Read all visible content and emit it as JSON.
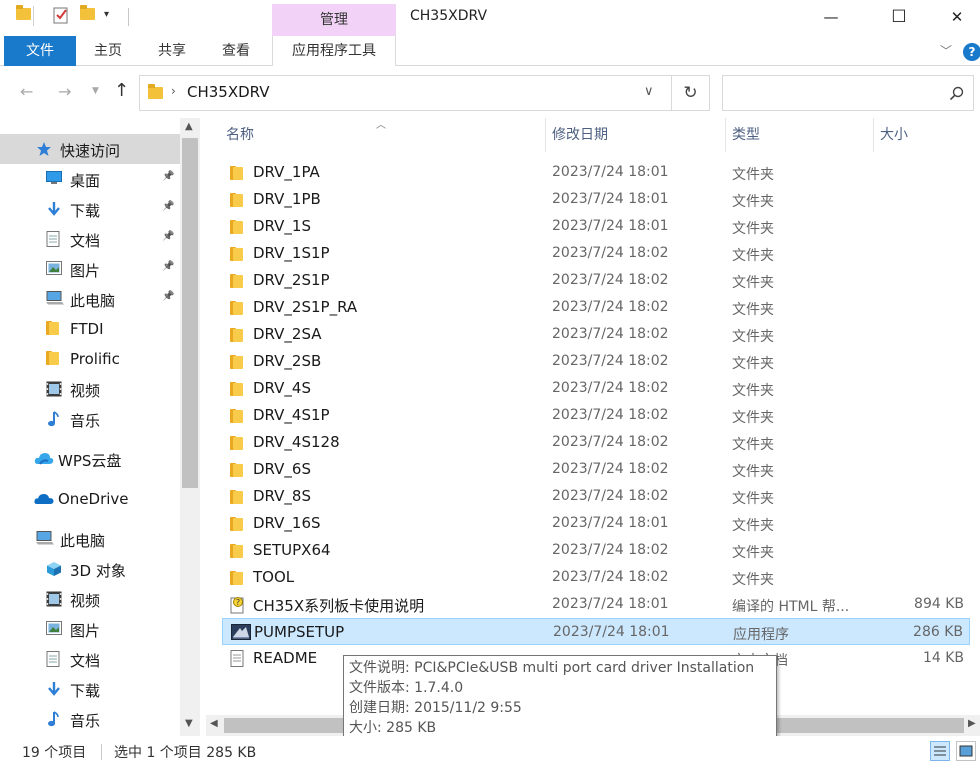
{
  "window": {
    "title": "CH35XDRV",
    "context_group_label": "管理",
    "minimize": "—",
    "maximize": "☐",
    "close": "✕"
  },
  "ribbon": {
    "tabs": [
      "文件",
      "主页",
      "共享",
      "查看",
      "应用程序工具"
    ],
    "help": "?"
  },
  "address": {
    "path": "CH35XDRV",
    "search_placeholder": ""
  },
  "nav": {
    "items": [
      {
        "label": "快速访问",
        "icon": "star-icon",
        "pinned": false
      },
      {
        "label": "桌面",
        "icon": "desktop-icon",
        "pinned": true
      },
      {
        "label": "下载",
        "icon": "download-icon",
        "pinned": true
      },
      {
        "label": "文档",
        "icon": "document-icon",
        "pinned": true
      },
      {
        "label": "图片",
        "icon": "picture-icon",
        "pinned": true
      },
      {
        "label": "此电脑",
        "icon": "computer-icon",
        "pinned": true
      },
      {
        "label": "FTDI",
        "icon": "folder-icon",
        "pinned": false
      },
      {
        "label": "Prolific",
        "icon": "folder-icon",
        "pinned": false
      },
      {
        "label": "视频",
        "icon": "video-icon",
        "pinned": false
      },
      {
        "label": "音乐",
        "icon": "music-icon",
        "pinned": false
      },
      {
        "label": "WPS云盘",
        "icon": "cloud-icon",
        "pinned": false
      },
      {
        "label": "OneDrive",
        "icon": "onedrive-icon",
        "pinned": false
      },
      {
        "label": "此电脑",
        "icon": "computer-icon",
        "pinned": false
      },
      {
        "label": "3D 对象",
        "icon": "cube-icon",
        "pinned": false
      },
      {
        "label": "视频",
        "icon": "video-icon",
        "pinned": false
      },
      {
        "label": "图片",
        "icon": "picture-icon",
        "pinned": false
      },
      {
        "label": "文档",
        "icon": "document-icon",
        "pinned": false
      },
      {
        "label": "下载",
        "icon": "download-icon",
        "pinned": false
      },
      {
        "label": "音乐",
        "icon": "music-icon",
        "pinned": false
      }
    ]
  },
  "columns": {
    "name": "名称",
    "date": "修改日期",
    "type": "类型",
    "size": "大小"
  },
  "files": [
    {
      "name": "DRV_1PA",
      "date": "2023/7/24 18:01",
      "type": "文件夹",
      "size": "",
      "icon": "folder-icon"
    },
    {
      "name": "DRV_1PB",
      "date": "2023/7/24 18:01",
      "type": "文件夹",
      "size": "",
      "icon": "folder-icon"
    },
    {
      "name": "DRV_1S",
      "date": "2023/7/24 18:01",
      "type": "文件夹",
      "size": "",
      "icon": "folder-icon"
    },
    {
      "name": "DRV_1S1P",
      "date": "2023/7/24 18:02",
      "type": "文件夹",
      "size": "",
      "icon": "folder-icon"
    },
    {
      "name": "DRV_2S1P",
      "date": "2023/7/24 18:02",
      "type": "文件夹",
      "size": "",
      "icon": "folder-icon"
    },
    {
      "name": "DRV_2S1P_RA",
      "date": "2023/7/24 18:02",
      "type": "文件夹",
      "size": "",
      "icon": "folder-icon"
    },
    {
      "name": "DRV_2SA",
      "date": "2023/7/24 18:02",
      "type": "文件夹",
      "size": "",
      "icon": "folder-icon"
    },
    {
      "name": "DRV_2SB",
      "date": "2023/7/24 18:02",
      "type": "文件夹",
      "size": "",
      "icon": "folder-icon"
    },
    {
      "name": "DRV_4S",
      "date": "2023/7/24 18:02",
      "type": "文件夹",
      "size": "",
      "icon": "folder-icon"
    },
    {
      "name": "DRV_4S1P",
      "date": "2023/7/24 18:02",
      "type": "文件夹",
      "size": "",
      "icon": "folder-icon"
    },
    {
      "name": "DRV_4S128",
      "date": "2023/7/24 18:02",
      "type": "文件夹",
      "size": "",
      "icon": "folder-icon"
    },
    {
      "name": "DRV_6S",
      "date": "2023/7/24 18:02",
      "type": "文件夹",
      "size": "",
      "icon": "folder-icon"
    },
    {
      "name": "DRV_8S",
      "date": "2023/7/24 18:02",
      "type": "文件夹",
      "size": "",
      "icon": "folder-icon"
    },
    {
      "name": "DRV_16S",
      "date": "2023/7/24 18:01",
      "type": "文件夹",
      "size": "",
      "icon": "folder-icon"
    },
    {
      "name": "SETUPX64",
      "date": "2023/7/24 18:02",
      "type": "文件夹",
      "size": "",
      "icon": "folder-icon"
    },
    {
      "name": "TOOL",
      "date": "2023/7/24 18:02",
      "type": "文件夹",
      "size": "",
      "icon": "folder-icon"
    },
    {
      "name": "CH35X系列板卡使用说明",
      "date": "2023/7/24 18:01",
      "type": "编译的 HTML 帮...",
      "size": "894 KB",
      "icon": "chm-help-icon"
    },
    {
      "name": "PUMPSETUP",
      "date": "2023/7/24 18:01",
      "type": "应用程序",
      "size": "286 KB",
      "icon": "setup-exe-icon",
      "selected": true
    },
    {
      "name": "README",
      "date": "",
      "type": "文本文档",
      "size": "14 KB",
      "icon": "text-file-icon"
    }
  ],
  "tooltip": {
    "lines": [
      "文件说明: PCI&PCIe&USB multi port card driver Installation",
      "文件版本: 1.7.4.0",
      "创建日期: 2015/11/2 9:55",
      "大小: 285 KB"
    ]
  },
  "status": {
    "count": "19 个项目",
    "selection": "选中 1 个项目  285 KB"
  }
}
